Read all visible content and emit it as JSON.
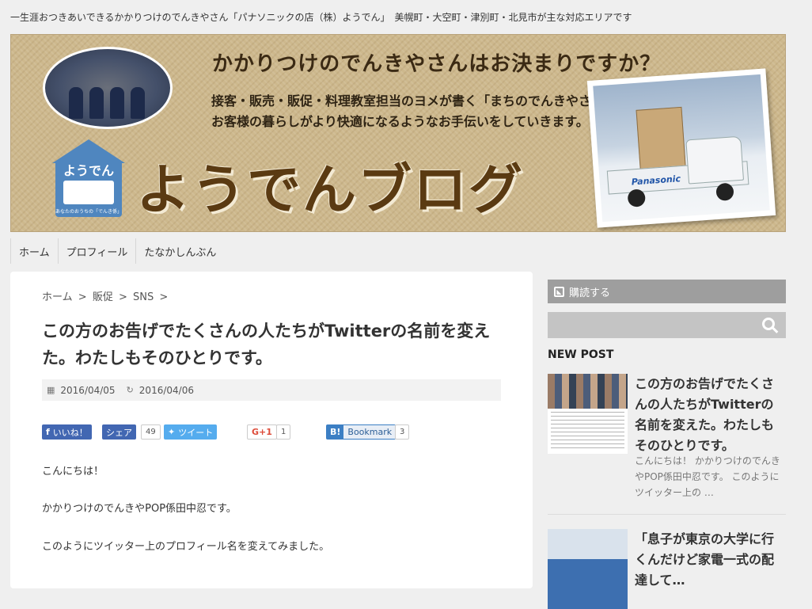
{
  "header": {
    "tagline": "一生涯おつきあいできるかかりつけのでんきやさん「パナソニックの店（株）ようでん」　美幌町・大空町・津別町・北見市が主な対応エリアです"
  },
  "banner": {
    "heading": "かかりつけのでんきやさんはお決まりですか？",
    "line1": "接客・販売・販促・料理教室担当のヨメが書く「まちのでんきやさん」の仕事。",
    "line2": "お客様の暮らしがより快適になるようなお手伝いをしていきます。",
    "logo_name": "ようでん",
    "logo_sub": "あなたのおうちの「でんき係」",
    "blog_title": "ようでんブログ",
    "truck_brand": "Panasonic"
  },
  "nav": {
    "items": [
      "ホーム",
      "プロフィール",
      "たなかしんぶん"
    ]
  },
  "breadcrumb": {
    "items": [
      "ホーム",
      "販促",
      "SNS"
    ],
    "separator": ">"
  },
  "post": {
    "title": "この方のお告げでたくさんの人たちがTwitterの名前を変えた。わたしもそのひとりです。",
    "published": "2016/04/05",
    "updated": "2016/04/06",
    "paragraphs": [
      "こんにちは！",
      "かかりつけのでんきやPOP係田中忍です。",
      "このようにツイッター上のプロフィール名を変えてみました。"
    ]
  },
  "share": {
    "facebook_like": "いいね！",
    "facebook_share": "シェア",
    "facebook_share_count": "49",
    "twitter": "ツイート",
    "gplus": "G+1",
    "gplus_count": "1",
    "hatena": "Bookmark",
    "hatena_glyph": "B!",
    "hatena_count": "3"
  },
  "sidebar": {
    "rss_label": "購読する",
    "search_placeholder": "",
    "new_post_heading": "NEW POST",
    "posts": [
      {
        "title": "この方のお告げでたくさんの人たちがTwitterの名前を変えた。わたしもそのひとりです。",
        "excerpt": "こんにちは！ かかりつけのでんきやPOP係田中忍です。 このようにツイッター上の …"
      },
      {
        "title": "「息子が東京の大学に行くんだけど家電一式の配達して…",
        "excerpt": ""
      }
    ]
  },
  "colors": {
    "facebook": "#4267b2",
    "twitter": "#55acee",
    "gplus": "#dd4b39",
    "hatena": "#3c7fc4",
    "sidebar_bar": "#9e9e9e",
    "banner_brown": "#5a3a12"
  }
}
